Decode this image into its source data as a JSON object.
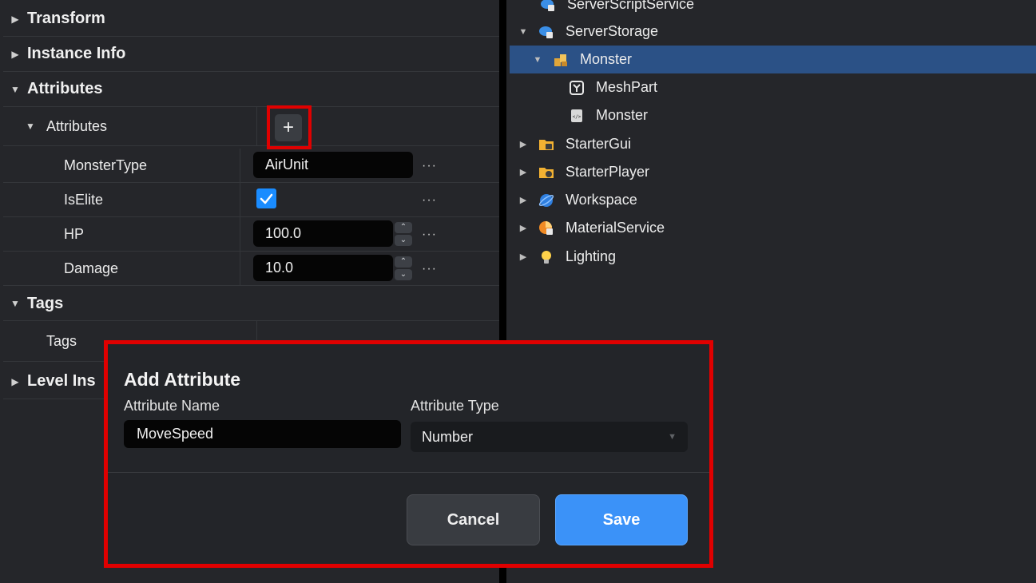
{
  "properties": {
    "sections": {
      "transform": "Transform",
      "instance_info": "Instance Info",
      "attributes": "Attributes",
      "tags": "Tags",
      "level_ins": "Level Ins"
    },
    "attributes_group_label": "Attributes",
    "add_button_symbol": "+",
    "rows": {
      "monster_type": {
        "name": "MonsterType",
        "value": "AirUnit"
      },
      "is_elite": {
        "name": "IsElite",
        "checked": true
      },
      "hp": {
        "name": "HP",
        "value": "100.0"
      },
      "damage": {
        "name": "Damage",
        "value": "10.0"
      }
    },
    "tags_label": "Tags",
    "more_symbol": "···"
  },
  "explorer": {
    "items": [
      {
        "label": "ServerScriptService",
        "icon": "server-script-service-icon",
        "expanded": null
      },
      {
        "label": "ServerStorage",
        "icon": "server-storage-icon",
        "expanded": true
      },
      {
        "label": "Monster",
        "icon": "model-icon",
        "expanded": true,
        "selected": true
      },
      {
        "label": "MeshPart",
        "icon": "meshpart-icon",
        "expanded": null
      },
      {
        "label": "Monster",
        "icon": "script-icon",
        "expanded": null
      },
      {
        "label": "StarterGui",
        "icon": "starter-gui-icon",
        "expanded": false
      },
      {
        "label": "StarterPlayer",
        "icon": "starter-player-icon",
        "expanded": false
      },
      {
        "label": "Workspace",
        "icon": "workspace-icon",
        "expanded": false
      },
      {
        "label": "MaterialService",
        "icon": "material-service-icon",
        "expanded": false
      },
      {
        "label": "Lighting",
        "icon": "lighting-icon",
        "expanded": false
      }
    ]
  },
  "dialog": {
    "title": "Add Attribute",
    "name_label": "Attribute Name",
    "name_value": "MoveSpeed",
    "type_label": "Attribute Type",
    "type_value": "Number",
    "cancel_label": "Cancel",
    "save_label": "Save"
  },
  "colors": {
    "accent": "#3b92f8",
    "selection": "#2b5186",
    "highlight": "#e00000",
    "checkbox": "#1a8cff"
  }
}
